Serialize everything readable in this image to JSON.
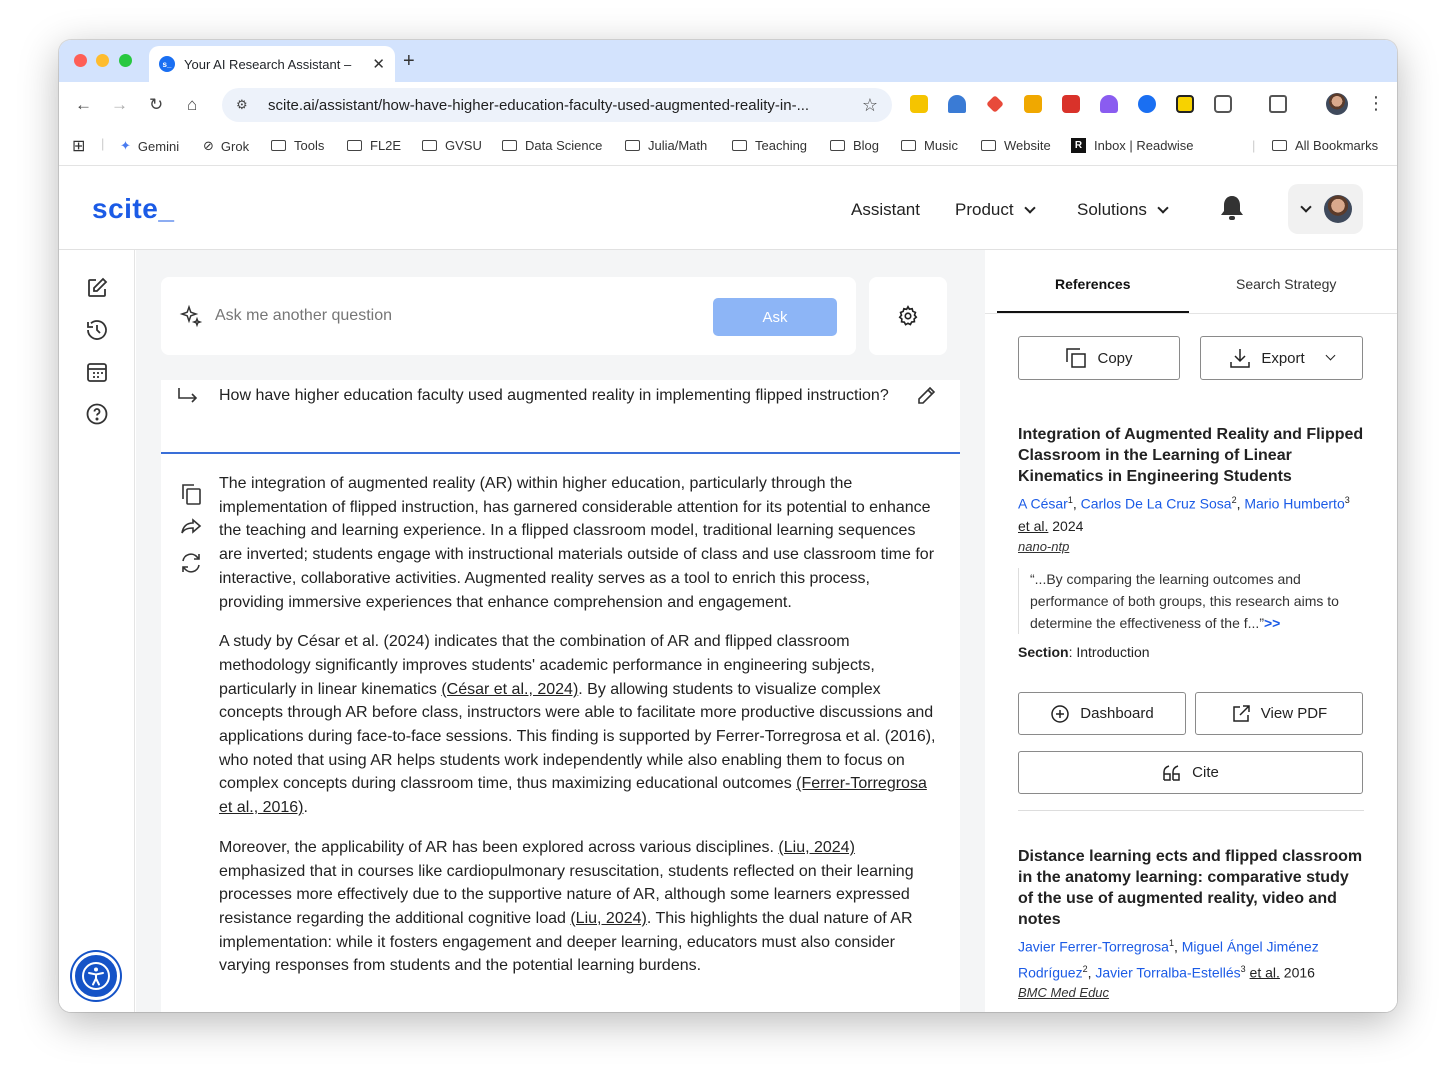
{
  "browser": {
    "tab_title": "Your AI Research Assistant –",
    "url": "scite.ai/assistant/how-have-higher-education-faculty-used-augmented-reality-in-...",
    "bookmarks": [
      "Gemini",
      "Grok",
      "Tools",
      "FL2E",
      "GVSU",
      "Data Science",
      "Julia/Math",
      "Teaching",
      "Blog",
      "Music",
      "Website",
      "Inbox | Readwise"
    ],
    "all_bookmarks": "All Bookmarks",
    "favicon_text": "s_"
  },
  "header": {
    "logo": "scite_",
    "nav": {
      "assistant": "Assistant",
      "product": "Product",
      "solutions": "Solutions"
    }
  },
  "ask": {
    "placeholder": "Ask me another question",
    "button": "Ask"
  },
  "question": "How have higher education faculty used augmented reality in implementing flipped instruction?",
  "answer": {
    "p1": "The integration of augmented reality (AR) within higher education, particularly through the implementation of flipped instruction, has garnered considerable attention for its potential to enhance the teaching and learning experience. In a flipped classroom model, traditional learning sequences are inverted; students engage with instructional materials outside of class and use classroom time for interactive, collaborative activities. Augmented reality serves as a tool to enrich this process, providing immersive experiences that enhance comprehension and engagement.",
    "p2a": "A study by César et al. (2024) indicates that the combination of AR and flipped classroom methodology significantly improves students' academic performance in engineering subjects, particularly in linear kinematics ",
    "p2c1": "(César et al., 2024)",
    "p2b": ". By allowing students to visualize complex concepts through AR before class, instructors were able to facilitate more productive discussions and applications during face-to-face sessions. This finding is supported by Ferrer-Torregrosa et al. (2016), who noted that using AR helps students work independently while also enabling them to focus on complex concepts during classroom time, thus maximizing educational outcomes ",
    "p2c2": "(Ferrer-Torregrosa et al., 2016)",
    "p2end": ".",
    "p3a": "Moreover, the applicability of AR has been explored across various disciplines. ",
    "p3c1": "(Liu, 2024)",
    "p3b": " emphasized that in courses like cardiopulmonary resuscitation, students reflected on their learning processes more effectively due to the supportive nature of AR, although some learners expressed resistance regarding the additional cognitive load ",
    "p3c2": "(Liu, 2024)",
    "p3d": ". This highlights the dual nature of AR implementation: while it fosters engagement and deeper learning, educators must also consider varying responses from students and the potential learning burdens."
  },
  "references_panel": {
    "tabs": {
      "references": "References",
      "strategy": "Search Strategy"
    },
    "copy": "Copy",
    "export": "Export",
    "ref1": {
      "title": "Integration of Augmented Reality and Flipped Classroom in the Learning of Linear Kinematics in Engineering Students",
      "a1": "A César",
      "s1": "1",
      "a2": "Carlos De La Cruz Sosa",
      "s2": "2",
      "a3": "Mario Humberto",
      "s3": "3",
      "etal": "et al.",
      "year": "2024",
      "journal": "nano-ntp",
      "quote": "“...By comparing the learning outcomes and performance of both groups, this research aims to determine the effectiveness of the f...”",
      "more": ">>",
      "section_label": "Section",
      "section": ": Introduction",
      "dashboard": "Dashboard",
      "viewpdf": "View PDF",
      "cite": "Cite"
    },
    "ref2": {
      "title": "Distance learning ects and flipped classroom in the anatomy learning: comparative study of the use of augmented reality, video and notes",
      "a1": "Javier Ferrer-Torregrosa",
      "s1": "1",
      "a2": "Miguel Ángel Jiménez Rodríguez",
      "s2": "2",
      "a3": "Javier Torralba-Estellés",
      "s3": "3",
      "etal": "et al.",
      "year": "2016",
      "journal": "BMC Med Educ"
    }
  },
  "colors": {
    "brand": "#1b5be6",
    "ask_button": "#8db5f6",
    "tabstrip": "#d3e3fd"
  }
}
